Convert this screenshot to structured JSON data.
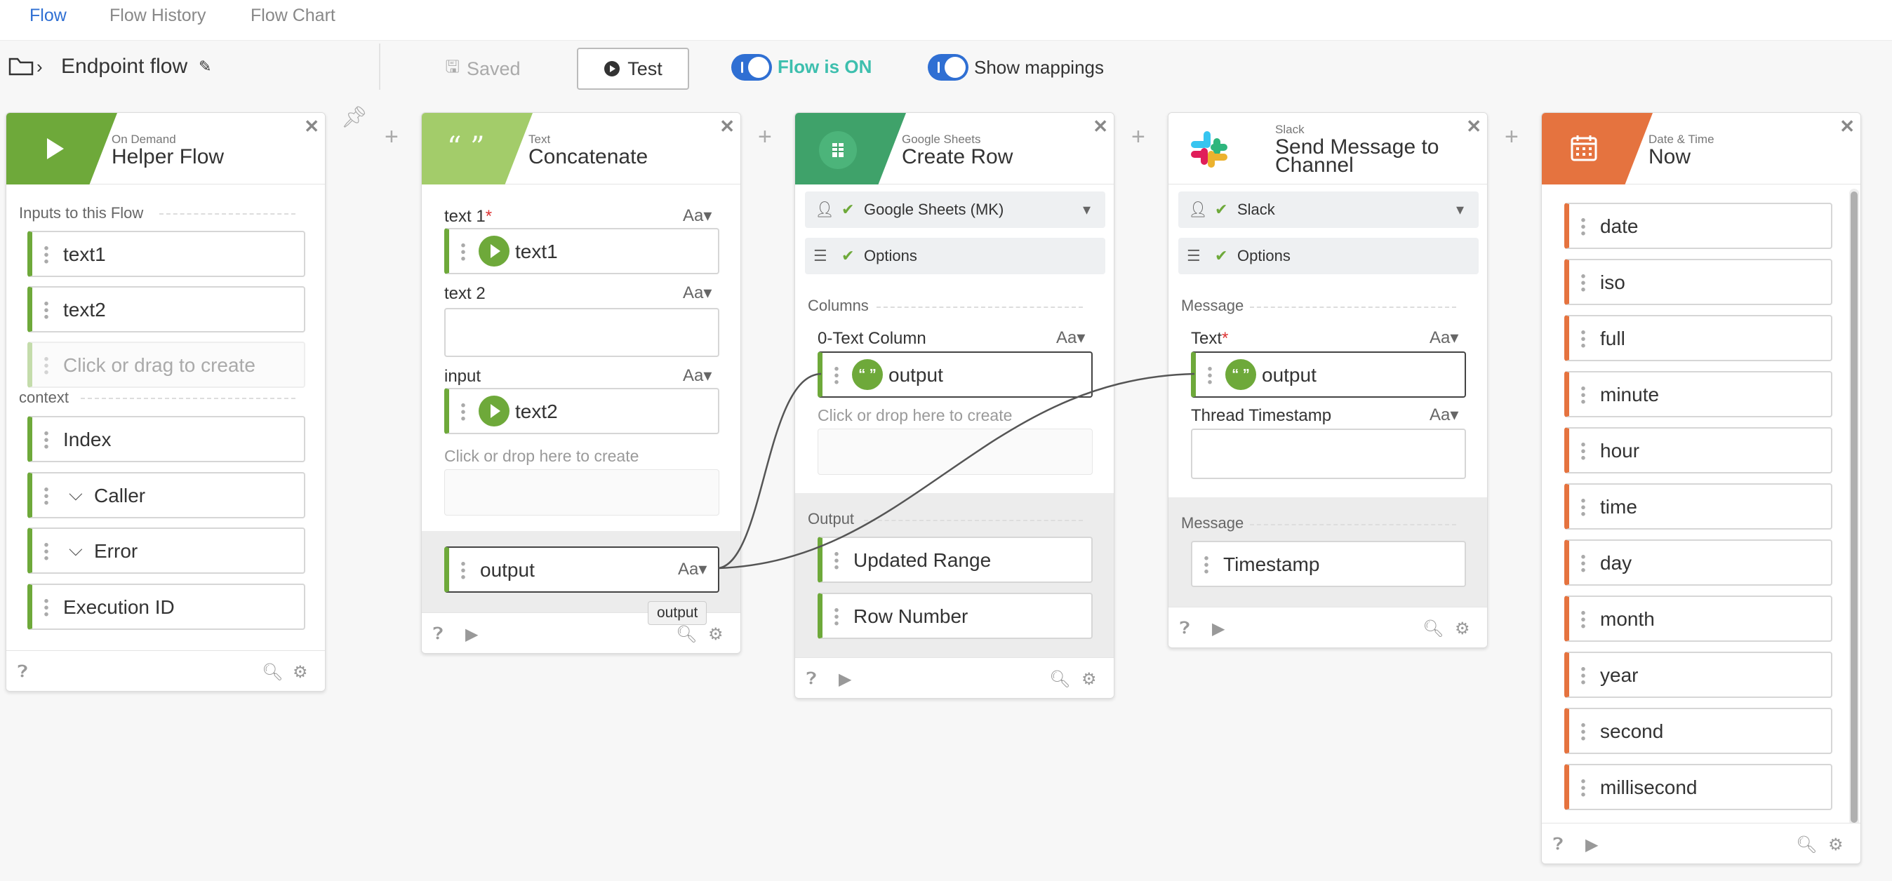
{
  "tabs": [
    {
      "label": "Flow",
      "active": true
    },
    {
      "label": "Flow History"
    },
    {
      "label": "Flow Chart"
    }
  ],
  "toolbar": {
    "flow_name": "Endpoint flow",
    "saved_label": "Saved",
    "test_label": "Test",
    "flow_on_label": "Flow is ON",
    "show_mappings_label": "Show mappings"
  },
  "cards": {
    "helper": {
      "small": "On Demand",
      "title": "Helper Flow",
      "inputs_label": "Inputs to this Flow",
      "inputs": [
        "text1",
        "text2"
      ],
      "create_placeholder": "Click or drag to create",
      "context_label": "context",
      "context": [
        "Index",
        "Caller",
        "Error",
        "Execution ID"
      ]
    },
    "concat": {
      "small": "Text",
      "title": "Concatenate",
      "text1_label": "text 1",
      "text1_value": "text1",
      "text2_label": "text 2",
      "input_label": "input",
      "input_value": "text2",
      "drop_hint": "Click or drop here to create",
      "output": "output",
      "tooltip": "output",
      "aa": "Aa"
    },
    "sheets": {
      "small": "Google Sheets",
      "title": "Create Row",
      "connection": "Google Sheets (MK)",
      "options": "Options",
      "columns_label": "Columns",
      "col0_label": "0-Text Column",
      "col0_value": "output",
      "drop_hint": "Click or drop here to create",
      "output_label": "Output",
      "outputs": [
        "Updated Range",
        "Row Number"
      ]
    },
    "slack": {
      "small": "Slack",
      "title_line1": "Send Message to",
      "title_line2": "Channel",
      "connection": "Slack",
      "options": "Options",
      "message_label": "Message",
      "text_label": "Text",
      "text_value": "output",
      "thread_label": "Thread Timestamp",
      "output_label": "Message",
      "outputs": [
        "Timestamp"
      ]
    },
    "datetime": {
      "small": "Date & Time",
      "title": "Now",
      "outputs": [
        "date",
        "iso",
        "full",
        "minute",
        "hour",
        "time",
        "day",
        "month",
        "year",
        "second",
        "millisecond"
      ]
    }
  },
  "colors": {
    "green": "#6ea93a",
    "sheets_green": "#3fa26a",
    "orange": "#e5733f",
    "blue": "#2f6fd3",
    "teal": "#3dbfae"
  }
}
